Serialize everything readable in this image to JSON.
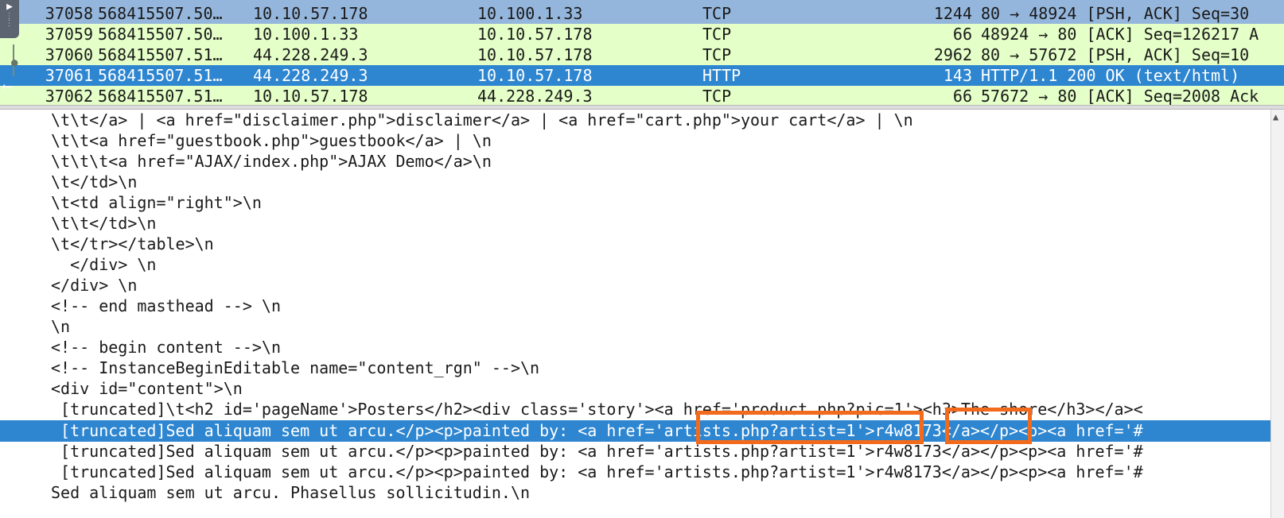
{
  "packets": [
    {
      "no": "37058",
      "time": "568415507.50…",
      "src": "10.10.57.178",
      "dst": "10.100.1.33",
      "proto": "TCP",
      "len": "1244",
      "info": "80 → 48924 [PSH, ACK] Seq=30"
    },
    {
      "no": "37059",
      "time": "568415507.50…",
      "src": "10.100.1.33",
      "dst": "10.10.57.178",
      "proto": "TCP",
      "len": "66",
      "info": "48924 → 80 [ACK] Seq=126217 A"
    },
    {
      "no": "37060",
      "time": "568415507.51…",
      "src": "44.228.249.3",
      "dst": "10.10.57.178",
      "proto": "TCP",
      "len": "2962",
      "info": "80 → 57672 [PSH, ACK] Seq=10"
    },
    {
      "no": "37061",
      "time": "568415507.51…",
      "src": "44.228.249.3",
      "dst": "10.10.57.178",
      "proto": "HTTP",
      "len": "143",
      "info": "HTTP/1.1 200 OK  (text/html)"
    },
    {
      "no": "37062",
      "time": "568415507.51…",
      "src": "10.10.57.178",
      "dst": "44.228.249.3",
      "proto": "TCP",
      "len": "66",
      "info": "57672 → 80 [ACK] Seq=2008 Ack"
    }
  ],
  "content_lines": [
    "\\t\\t</a> | <a href=\"disclaimer.php\">disclaimer</a> | <a href=\"cart.php\">your cart</a> | \\n",
    "\\t\\t<a href=\"guestbook.php\">guestbook</a> | \\n",
    "\\t\\t\\t<a href=\"AJAX/index.php\">AJAX Demo</a>\\n",
    "\\t</td>\\n",
    "\\t<td align=\"right\">\\n",
    "\\t\\t</td>\\n",
    "\\t</tr></table>\\n",
    "  </div> \\n",
    "</div> \\n",
    "<!-- end masthead --> \\n",
    "\\n",
    "<!-- begin content -->\\n",
    "<!-- InstanceBeginEditable name=\"content_rgn\" -->\\n",
    "<div id=\"content\">\\n",
    " [truncated]\\t<h2 id='pageName'>Posters</h2><div class='story'><a href='product.php?pic=1'><h3>The shore</h3></a><",
    " [truncated]Sed aliquam sem ut arcu.</p><p>painted by: <a href='artists.php?artist=1'>r4w8173</a></p><p><a href='#",
    " [truncated]Sed aliquam sem ut arcu.</p><p>painted by: <a href='artists.php?artist=1'>r4w8173</a></p><p><a href='#",
    " [truncated]Sed aliquam sem ut arcu.</p><p>painted by: <a href='artists.php?artist=1'>r4w8173</a></p><p><a href='#",
    "Sed aliquam sem ut arcu. Phasellus sollicitudin.\\n"
  ],
  "selected_content_line": 15,
  "selected_packet": "37061",
  "colors": {
    "tcp_row_bg": "#e4ffc7",
    "selection_dark": "#2e86d1",
    "selection_light": "#95b6dc",
    "annotation_box": "#f26a1b"
  },
  "icons": {
    "corner": "play-menu-icon",
    "scroll_up": "scroll-up-arrow-icon"
  }
}
